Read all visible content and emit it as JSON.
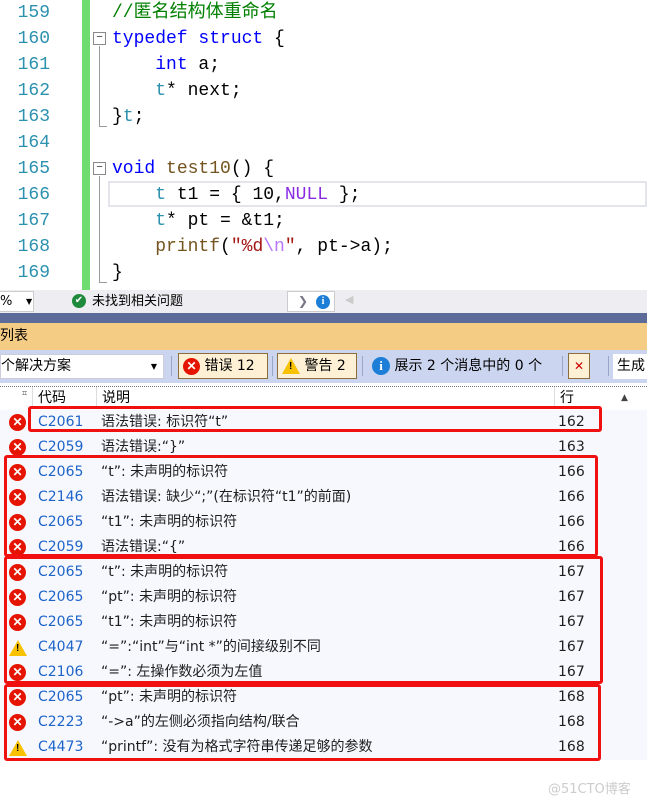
{
  "editor": {
    "lines": [
      {
        "num": "159"
      },
      {
        "num": "160"
      },
      {
        "num": "161"
      },
      {
        "num": "162"
      },
      {
        "num": "163"
      },
      {
        "num": "164"
      },
      {
        "num": "165"
      },
      {
        "num": "166"
      },
      {
        "num": "167"
      },
      {
        "num": "168"
      },
      {
        "num": "169"
      }
    ],
    "code": {
      "l159": "//匿名结构体重命名",
      "l160_kw": "typedef struct",
      "l160_rest": " {",
      "l161_kw": "int",
      "l161_rest": " a;",
      "l162_ty": "t",
      "l162_rest": "* next;",
      "l163_a": "}",
      "l163_ty": "t",
      "l163_b": ";",
      "l165_kw": "void",
      "l165_fn": " test10",
      "l165_rest": "() {",
      "l166_ty": "t",
      "l166_a": " t1 = { 10,",
      "l166_mac": "NULL",
      "l166_b": " };",
      "l167_ty": "t",
      "l167_rest": "* pt = &t1;",
      "l168_fn": "printf",
      "l168_a": "(",
      "l168_str1": "\"%d",
      "l168_esc": "\\n",
      "l168_str2": "\"",
      "l168_b": ", pt->a);",
      "l169": "}"
    }
  },
  "statusbar": {
    "zoom": "%",
    "issues": "未找到相关问题"
  },
  "panel": {
    "title": "列表",
    "scope": "个解决方案",
    "errors_label": "错误 12",
    "warnings_label": "警告 2",
    "messages_label": "展示 2 个消息中的 0 个",
    "build_label": "生成"
  },
  "columns": {
    "code": "代码",
    "desc": "说明",
    "line": "行"
  },
  "rows": [
    {
      "type": "error",
      "code": "C2061",
      "desc": "语法错误: 标识符“t”",
      "line": "162"
    },
    {
      "type": "error",
      "code": "C2059",
      "desc": "语法错误:“}”",
      "line": "163"
    },
    {
      "type": "error",
      "code": "C2065",
      "desc": "“t”: 未声明的标识符",
      "line": "166"
    },
    {
      "type": "error",
      "code": "C2146",
      "desc": "语法错误: 缺少“;”(在标识符“t1”的前面)",
      "line": "166"
    },
    {
      "type": "error",
      "code": "C2065",
      "desc": "“t1”: 未声明的标识符",
      "line": "166"
    },
    {
      "type": "error",
      "code": "C2059",
      "desc": "语法错误:“{”",
      "line": "166"
    },
    {
      "type": "error",
      "code": "C2065",
      "desc": "“t”: 未声明的标识符",
      "line": "167"
    },
    {
      "type": "error",
      "code": "C2065",
      "desc": "“pt”: 未声明的标识符",
      "line": "167"
    },
    {
      "type": "error",
      "code": "C2065",
      "desc": "“t1”: 未声明的标识符",
      "line": "167"
    },
    {
      "type": "warning",
      "code": "C4047",
      "desc": "“=”:“int”与“int *”的间接级别不同",
      "line": "167"
    },
    {
      "type": "error",
      "code": "C2106",
      "desc": "“=”: 左操作数必须为左值",
      "line": "167"
    },
    {
      "type": "error",
      "code": "C2065",
      "desc": "“pt”: 未声明的标识符",
      "line": "168"
    },
    {
      "type": "error",
      "code": "C2223",
      "desc": "“->a”的左侧必须指向结构/联合",
      "line": "168"
    },
    {
      "type": "warning",
      "code": "C4473",
      "desc": "“printf”: 没有为格式字符串传递足够的参数",
      "line": "168"
    }
  ],
  "watermark": "@51CTO博客",
  "colors": {
    "error": "#e51400",
    "warning": "#f8c200",
    "highlight_box": "#f01010",
    "code_link": "#1e64c8"
  }
}
